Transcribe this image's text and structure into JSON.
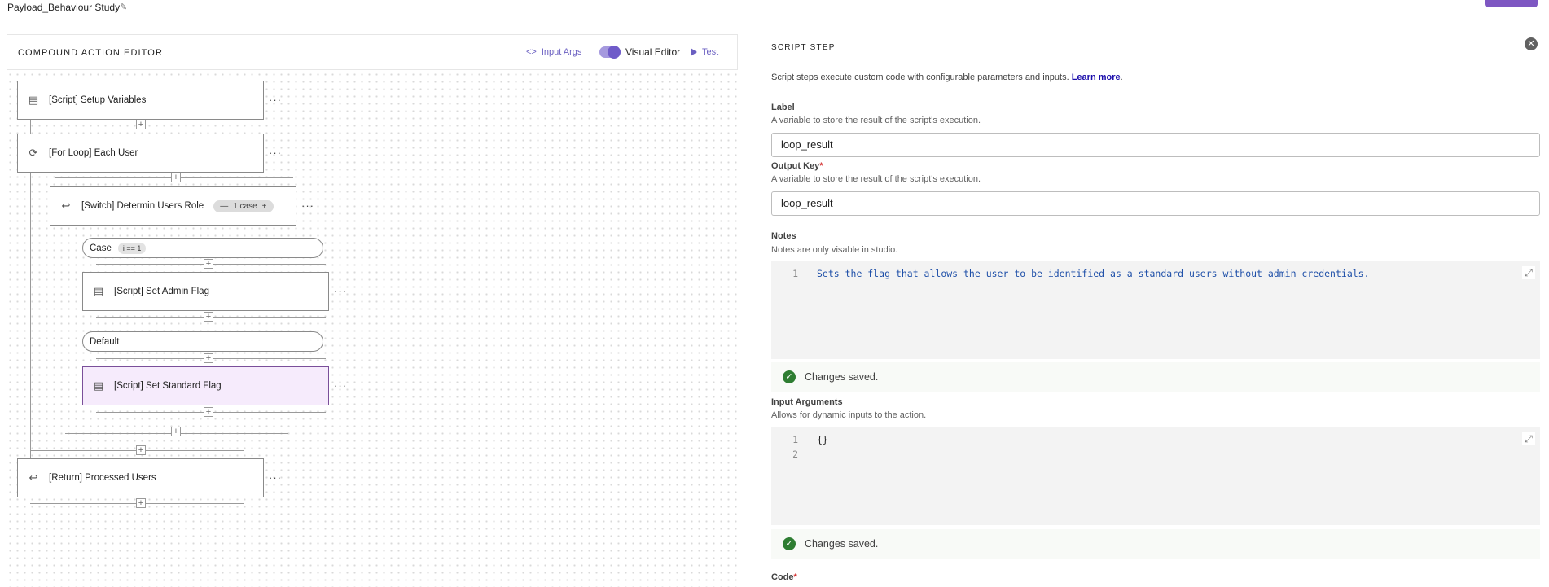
{
  "topbar": {
    "title": "Payload_Behaviour Study"
  },
  "editor": {
    "title": "COMPOUND ACTION EDITOR",
    "input_args_label": "Input Args",
    "visual_editor_label": "Visual Editor",
    "test_label": "Test",
    "nodes": {
      "setup": "[Script] Setup Variables",
      "loop": "[For Loop] Each User",
      "switch": "[Switch] Determin Users Role",
      "switch_badge": "1 case",
      "case_label": "Case",
      "case_condition": "i == 1",
      "admin": "[Script] Set Admin Flag",
      "default_label": "Default",
      "standard": "[Script] Set Standard Flag",
      "return": "[Return] Processed Users"
    }
  },
  "panel": {
    "title": "SCRIPT STEP",
    "intro_text": "Script steps execute custom code with configurable parameters and inputs. ",
    "learn_more": "Learn more",
    "intro_end": ".",
    "label": {
      "title": "Label",
      "help": "A variable to store the result of the script's execution.",
      "value": "loop_result"
    },
    "output_key": {
      "title": "Output Key",
      "required": "*",
      "help": "A variable to store the result of the script's execution.",
      "value": "loop_result"
    },
    "notes": {
      "title": "Notes",
      "help": "Notes are only visable in studio.",
      "line1_no": "1",
      "line1": "Sets the flag that allows the user to be identified as a standard users without admin credentials."
    },
    "notes_saved": "Changes saved.",
    "input_args": {
      "title": "Input Arguments",
      "help": "Allows for dynamic inputs to the action.",
      "line1_no": "1",
      "line1": "{}",
      "line2_no": "2"
    },
    "args_saved": "Changes saved.",
    "code": {
      "title": "Code",
      "required": "*"
    }
  }
}
